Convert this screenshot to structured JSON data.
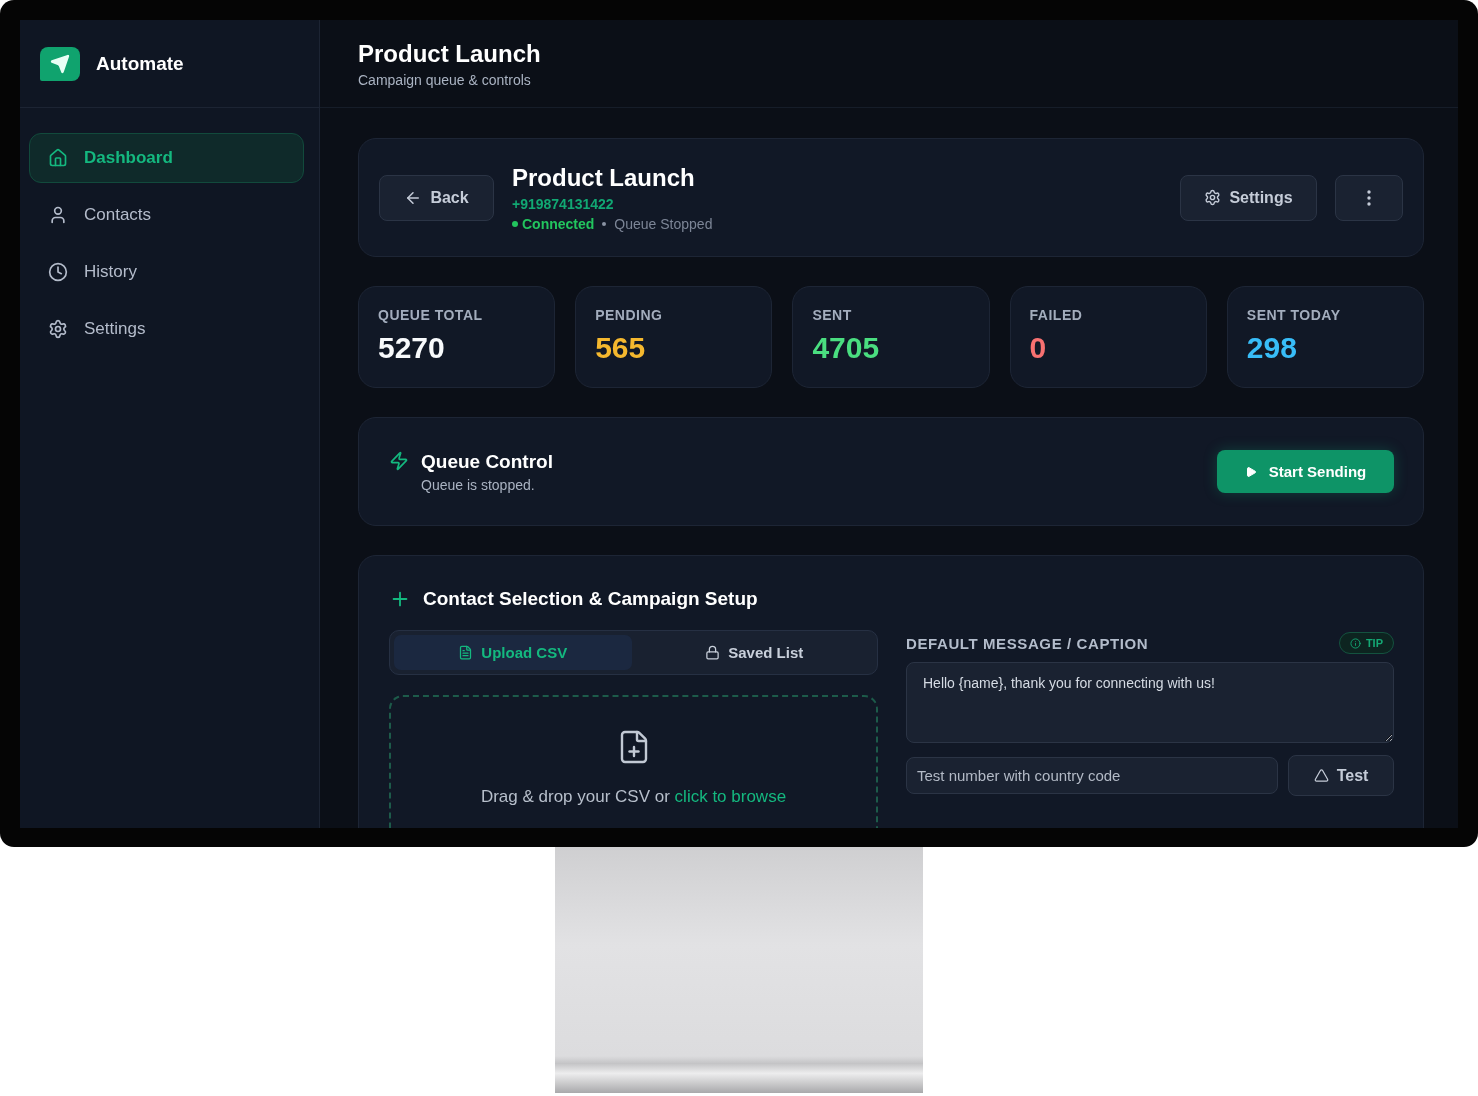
{
  "sidebar": {
    "brand": "Automate",
    "items": [
      {
        "label": "Dashboard",
        "selected": true
      },
      {
        "label": "Contacts",
        "selected": false
      },
      {
        "label": "History",
        "selected": false
      },
      {
        "label": "Settings",
        "selected": false
      }
    ]
  },
  "header": {
    "title": "Product Launch",
    "subtitle": "Campaign queue & controls"
  },
  "campaign": {
    "back": "Back",
    "title": "Product Launch",
    "phone": "+919874131422",
    "connected": true,
    "status": "Connected",
    "queue_state": "Queue Stopped",
    "settings": "Settings"
  },
  "stats": [
    {
      "label": "QUEUE TOTAL",
      "value": "5270",
      "color": "#f8fafc"
    },
    {
      "label": "PENDING",
      "value": "565",
      "color": "#f5b82e"
    },
    {
      "label": "SENT",
      "value": "4705",
      "color": "#4ade80"
    },
    {
      "label": "FAILED",
      "value": "0",
      "color": "#f87171"
    },
    {
      "label": "SENT TODAY",
      "value": "298",
      "color": "#38bdf8"
    }
  ],
  "queue_control": {
    "title": "Queue Control",
    "subtitle": "Queue is stopped.",
    "button": "Start Sending"
  },
  "setup": {
    "title": "Contact Selection & Campaign Setup",
    "tabs": [
      {
        "label": "Upload CSV",
        "selected": true
      },
      {
        "label": "Saved List",
        "selected": false
      }
    ],
    "dropzone": {
      "text": "Drag & drop your CSV or",
      "link": "click to browse"
    },
    "message_label": "DEFAULT MESSAGE / CAPTION",
    "tip": "TIP",
    "message": "Hello {name}, thank you for connecting with us!",
    "test_field": {
      "placeholder": "Test number with country code"
    },
    "test_button": "Test"
  }
}
